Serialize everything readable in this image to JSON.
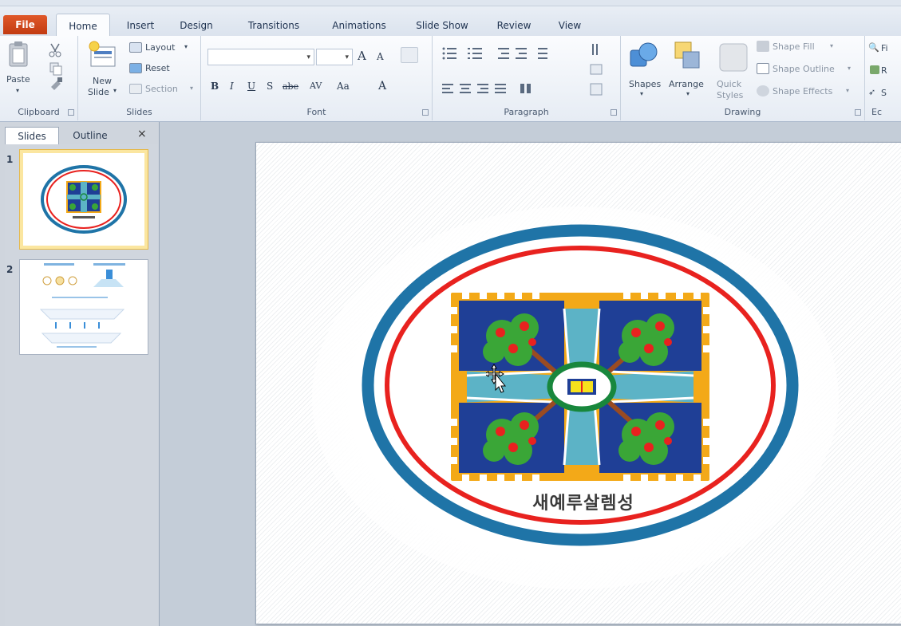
{
  "ribbon_tabs": {
    "file": "File",
    "home": "Home",
    "insert": "Insert",
    "design": "Design",
    "transitions": "Transitions",
    "animations": "Animations",
    "slide_show": "Slide Show",
    "review": "Review",
    "view": "View"
  },
  "clipboard": {
    "label": "Clipboard",
    "paste": "Paste"
  },
  "slides_group": {
    "label": "Slides",
    "new_slide_line1": "New",
    "new_slide_line2": "Slide",
    "layout": "Layout",
    "reset": "Reset",
    "section": "Section"
  },
  "font_group": {
    "label": "Font",
    "grow": "A",
    "shrink": "A",
    "bold": "B",
    "italic": "I",
    "underline": "U",
    "shadow": "S",
    "strike": "abe",
    "spacing": "AV",
    "case": "Aa",
    "color": "A"
  },
  "paragraph_group": {
    "label": "Paragraph"
  },
  "drawing_group": {
    "label": "Drawing",
    "shapes": "Shapes",
    "arrange": "Arrange",
    "quick_styles_line1": "Quick",
    "quick_styles_line2": "Styles",
    "shape_fill": "Shape Fill",
    "shape_outline": "Shape Outline",
    "shape_effects": "Shape Effects"
  },
  "editing_group": {
    "label": "Ec",
    "find": "Fi",
    "replace": "R",
    "select": "S"
  },
  "panel": {
    "tab_slides": "Slides",
    "tab_outline": "Outline",
    "close": "×",
    "thumb1_num": "1",
    "thumb2_num": "2"
  },
  "slide": {
    "caption": "새예루살렘성"
  },
  "colors": {
    "outer_ring": "#1f74a7",
    "inner_ring": "#e8221f",
    "tile_blue": "#1f3f96",
    "cross_teal": "#5cb3c6",
    "gold": "#f3a918",
    "tree_green": "#3aa637",
    "fruit_red": "#e8221f",
    "center_ring": "#18873c"
  }
}
